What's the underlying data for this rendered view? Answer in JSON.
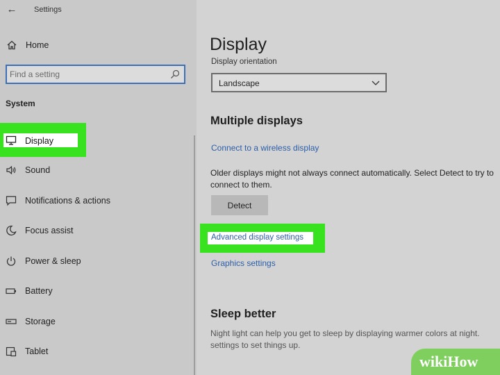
{
  "window": {
    "title": "Settings"
  },
  "sidebar": {
    "home_label": "Home",
    "search_placeholder": "Find a setting",
    "section_header": "System",
    "items": [
      {
        "label": "Display",
        "icon": "monitor-icon",
        "selected": true
      },
      {
        "label": "Sound",
        "icon": "speaker-icon"
      },
      {
        "label": "Notifications & actions",
        "icon": "notification-icon"
      },
      {
        "label": "Focus assist",
        "icon": "moon-icon"
      },
      {
        "label": "Power & sleep",
        "icon": "power-icon"
      },
      {
        "label": "Battery",
        "icon": "battery-icon"
      },
      {
        "label": "Storage",
        "icon": "storage-icon"
      },
      {
        "label": "Tablet",
        "icon": "tablet-icon"
      }
    ]
  },
  "main": {
    "title": "Display",
    "orientation": {
      "label": "Display orientation",
      "value": "Landscape"
    },
    "multiple_displays": {
      "heading": "Multiple displays",
      "wireless_link": "Connect to a wireless display",
      "description": "Older displays might not always connect automatically. Select Detect to try to connect to them.",
      "detect_button": "Detect",
      "advanced_link": "Advanced display settings",
      "graphics_link": "Graphics settings"
    },
    "sleep_better": {
      "heading": "Sleep better",
      "description": "Night light can help you get to sleep by displaying warmer colors at night. settings to set things up."
    }
  },
  "watermark": {
    "text": "wikiHow"
  },
  "colors": {
    "highlight": "#38e21e",
    "link": "#2b5ea8",
    "search_border": "#3c6fb4"
  }
}
